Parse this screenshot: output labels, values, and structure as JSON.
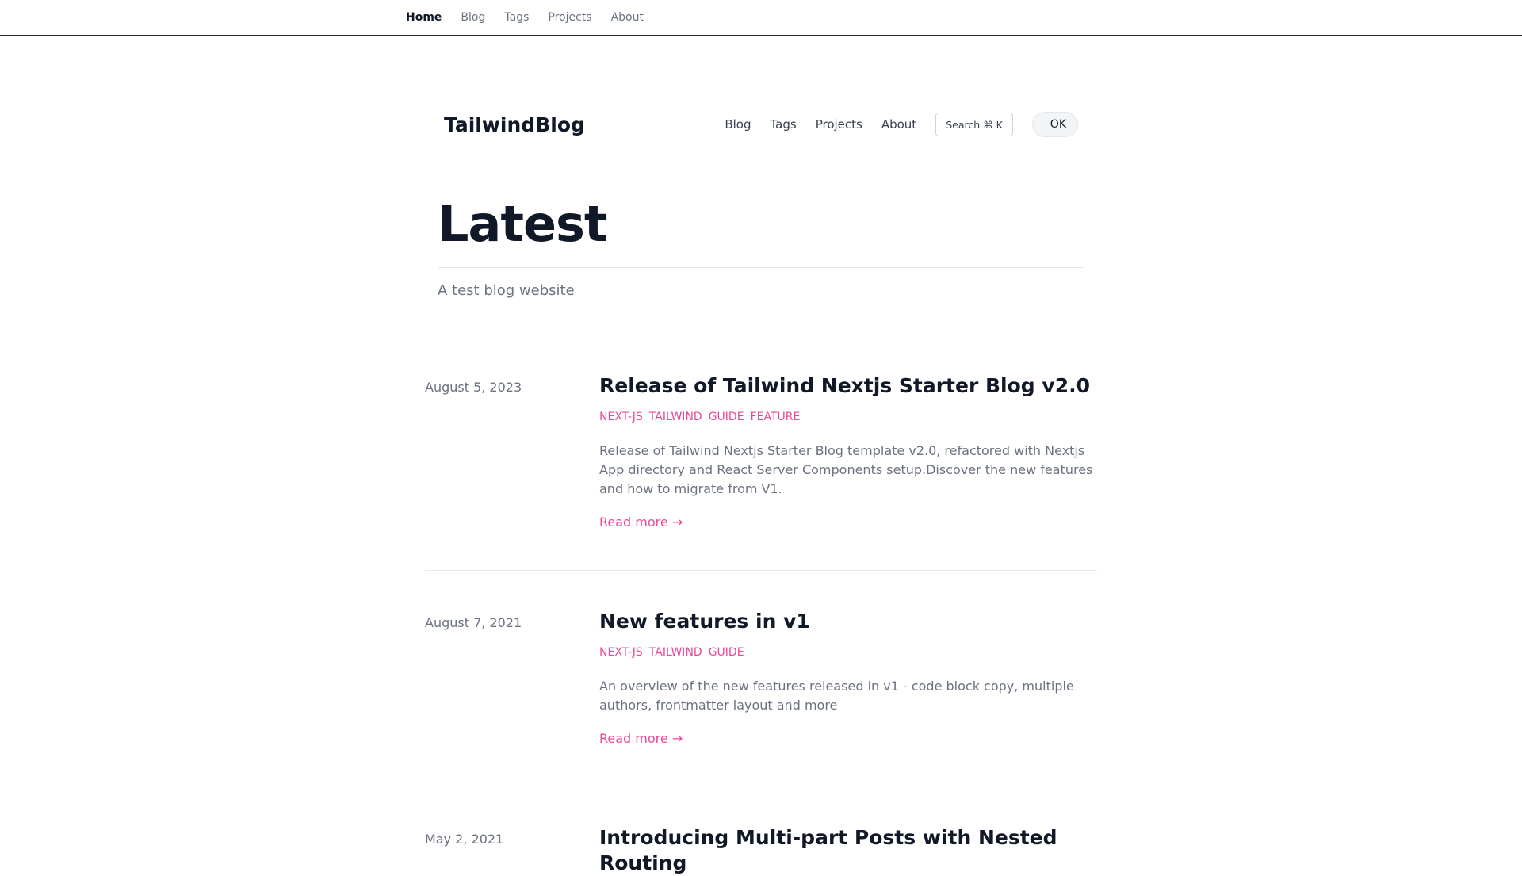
{
  "topnav": {
    "items": [
      {
        "label": "Home",
        "active": true
      },
      {
        "label": "Blog"
      },
      {
        "label": "Tags"
      },
      {
        "label": "Projects"
      },
      {
        "label": "About"
      }
    ]
  },
  "header": {
    "brand": "TailwindBlog",
    "nav": [
      "Blog",
      "Tags",
      "Projects",
      "About"
    ],
    "search_label": "Search ⌘ K",
    "ok_label": "OK"
  },
  "hero": {
    "title": "Latest",
    "subtitle": "A test blog website"
  },
  "posts": [
    {
      "date": "August 5, 2023",
      "title": "Release of Tailwind Nextjs Starter Blog v2.0",
      "tags": [
        "NEXT-JS",
        "TAILWIND",
        "GUIDE",
        "FEATURE"
      ],
      "summary": "Release of Tailwind Nextjs Starter Blog template v2.0, refactored with Nextjs App directory and React Server Components setup.Discover the new features and how to migrate from V1.",
      "read_more": "Read more →"
    },
    {
      "date": "August 7, 2021",
      "title": "New features in v1",
      "tags": [
        "NEXT-JS",
        "TAILWIND",
        "GUIDE"
      ],
      "summary": "An overview of the new features released in v1 - code block copy, multiple authors, frontmatter layout and more",
      "read_more": "Read more →"
    },
    {
      "date": "May 2, 2021",
      "title": "Introducing Multi-part Posts with Nested Routing"
    }
  ],
  "colors": {
    "accent": "#ec4899",
    "text": "#111827",
    "muted": "#6b7280",
    "divider": "#e5e7eb"
  }
}
